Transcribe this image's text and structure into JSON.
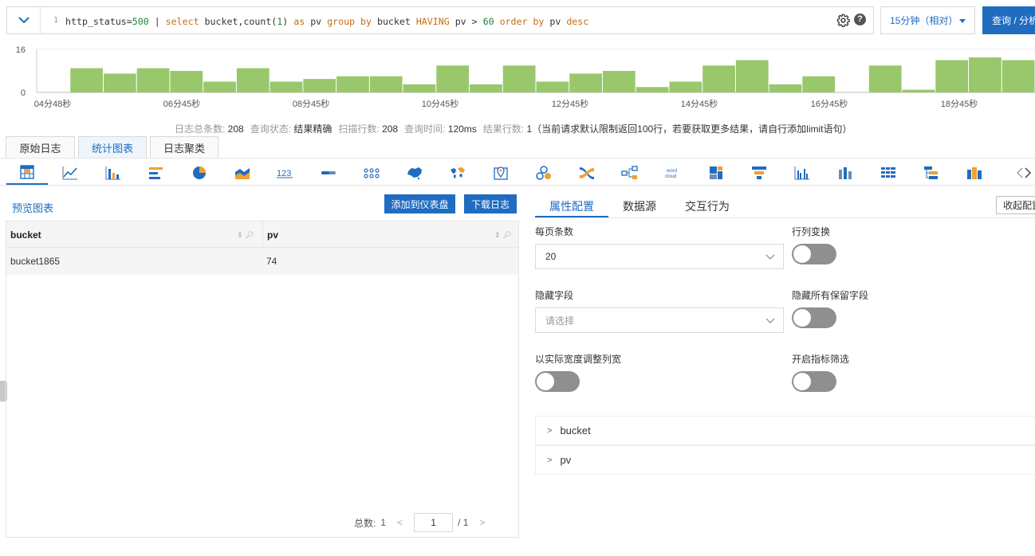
{
  "query": {
    "line_number": "1",
    "tokens": [
      {
        "t": "http_status",
        "c": "plain"
      },
      {
        "t": "=",
        "c": "plain"
      },
      {
        "t": "500",
        "c": "num"
      },
      {
        "t": " | ",
        "c": "plain"
      },
      {
        "t": "select",
        "c": "kw"
      },
      {
        "t": " bucket,count(",
        "c": "plain"
      },
      {
        "t": "1",
        "c": "num"
      },
      {
        "t": ") ",
        "c": "plain"
      },
      {
        "t": "as",
        "c": "kw"
      },
      {
        "t": " pv ",
        "c": "plain"
      },
      {
        "t": "group by",
        "c": "kw"
      },
      {
        "t": " bucket ",
        "c": "plain"
      },
      {
        "t": "HAVING",
        "c": "kw"
      },
      {
        "t": " pv > ",
        "c": "plain"
      },
      {
        "t": "60",
        "c": "num"
      },
      {
        "t": " ",
        "c": "plain"
      },
      {
        "t": "order by",
        "c": "kw"
      },
      {
        "t": " pv ",
        "c": "plain"
      },
      {
        "t": "desc",
        "c": "kw"
      }
    ],
    "time_range": "15分钟（相对）",
    "submit_label": "查询 / 分析"
  },
  "chart_data": {
    "type": "bar",
    "ylim": [
      0,
      16
    ],
    "y_ticks": [
      "16",
      "0"
    ],
    "x_tick_labels": [
      "04分48秒",
      "06分45秒",
      "08分45秒",
      "10分45秒",
      "12分45秒",
      "14分45秒",
      "16分45秒",
      "18分45秒"
    ],
    "values": [
      0,
      9,
      7,
      9,
      8,
      4,
      9,
      4,
      5,
      6,
      6,
      3,
      10,
      3,
      10,
      4,
      7,
      8,
      2,
      4,
      10,
      12,
      3,
      6,
      0,
      10,
      1,
      12,
      13,
      12
    ],
    "bar_color": "#99c76b"
  },
  "stats": [
    {
      "label": "日志总条数:",
      "value": "208"
    },
    {
      "label": "查询状态:",
      "value": "结果精确"
    },
    {
      "label": "扫描行数:",
      "value": "208"
    },
    {
      "label": "查询时间:",
      "value": "120ms"
    },
    {
      "label": "结果行数:",
      "value": "1（当前请求默认限制返回100行，若要获取更多结果，请自行添加limit语句）"
    }
  ],
  "main_tabs": [
    "原始日志",
    "统计图表",
    "日志聚类"
  ],
  "preview": {
    "title": "预览图表",
    "add_dashboard": "添加到仪表盘",
    "download": "下载日志",
    "columns": [
      "bucket",
      "pv"
    ],
    "rows": [
      [
        "bucket1865",
        "74"
      ]
    ],
    "total_label": "总数:",
    "total_value": "1",
    "page_current": "1",
    "page_total": "/ 1"
  },
  "config": {
    "tabs": [
      "属性配置",
      "数据源",
      "交互行为"
    ],
    "collapse_label": "收起配置",
    "page_size_label": "每页条数",
    "page_size_value": "20",
    "transpose_label": "行列变换",
    "hide_fields_label": "隐藏字段",
    "hide_fields_placeholder": "请选择",
    "hide_reserved_label": "隐藏所有保留字段",
    "auto_width_label": "以实际宽度调整列宽",
    "metric_filter_label": "开启指标筛选",
    "fields": [
      "bucket",
      "pv"
    ]
  },
  "colors": {
    "accent": "#1f6cc1",
    "bar": "#99c76b",
    "keyword": "#c26e17",
    "number": "#1a7f37"
  }
}
